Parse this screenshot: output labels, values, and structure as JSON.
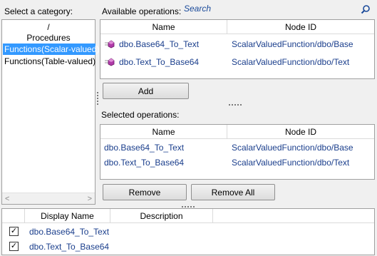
{
  "category": {
    "label": "Select a category:",
    "items": [
      "/",
      "Procedures",
      "Functions(Scalar-valued)",
      "Functions(Table-valued)"
    ],
    "selected_index": 2,
    "scroll_left": "<",
    "scroll_right": ">"
  },
  "available": {
    "label": "Available operations:",
    "search_placeholder": "Search",
    "columns": [
      "Name",
      "Node ID"
    ],
    "rows": [
      {
        "name": "dbo.Base64_To_Text",
        "node": "ScalarValuedFunction/dbo/Base"
      },
      {
        "name": "dbo.Text_To_Base64",
        "node": "ScalarValuedFunction/dbo/Text"
      }
    ],
    "add_label": "Add"
  },
  "selected": {
    "label": "Selected operations:",
    "columns": [
      "Name",
      "Node ID"
    ],
    "rows": [
      {
        "name": "dbo.Base64_To_Text",
        "node": "ScalarValuedFunction/dbo/Base"
      },
      {
        "name": "dbo.Text_To_Base64",
        "node": "ScalarValuedFunction/dbo/Text"
      }
    ],
    "remove_label": "Remove",
    "remove_all_label": "Remove All"
  },
  "display": {
    "columns": [
      "Display Name",
      "Description"
    ],
    "rows": [
      {
        "checked": true,
        "name": "dbo.Base64_To_Text",
        "description": ""
      },
      {
        "checked": true,
        "name": "dbo.Text_To_Base64",
        "description": ""
      }
    ],
    "check_glyph": "✓"
  },
  "colors": {
    "selection_bg": "#3399ff",
    "link_text": "#1a3e8c",
    "search_text": "#1a4a9a"
  }
}
